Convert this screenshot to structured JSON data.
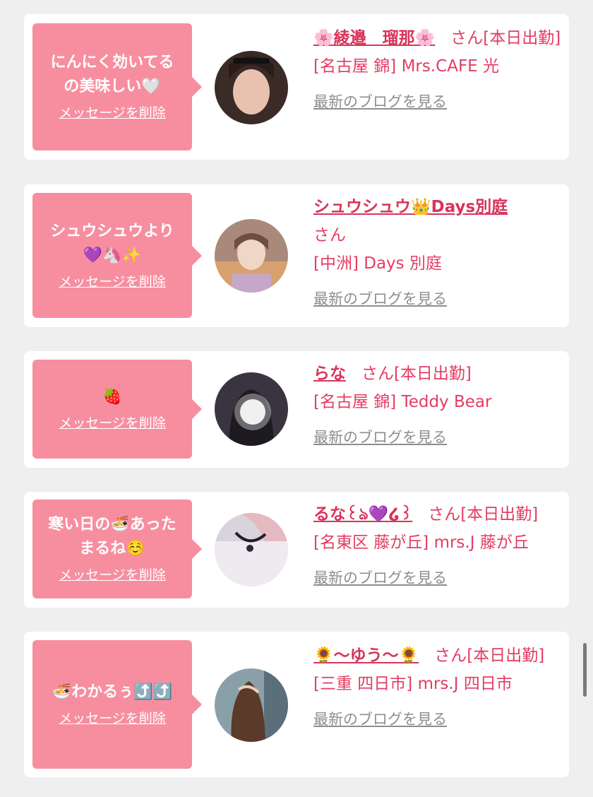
{
  "items": [
    {
      "message": "にんにく効いてる\nの美味しい🤍",
      "delete_label": "メッセージを削除",
      "name": "🌸綾邉　瑠那🌸",
      "suffix": "さん[本日出勤]",
      "shop": "[名古屋 錦] Mrs.CAFE 光",
      "blog_label": "最新のブログを見る"
    },
    {
      "message": "シュウシュウより\n💜🦄✨",
      "delete_label": "メッセージを削除",
      "name": "シュウシュウ👑Days別庭",
      "suffix": "さん",
      "shop": "[中洲] Days 別庭",
      "blog_label": "最新のブログを見る"
    },
    {
      "message": "🍓",
      "delete_label": "メッセージを削除",
      "name": "らな",
      "suffix": "さん[本日出勤]",
      "shop": "[名古屋 錦] Teddy Bear",
      "blog_label": "最新のブログを見る"
    },
    {
      "message": "寒い日の🍜あった\nまるね☺️",
      "delete_label": "メッセージを削除",
      "name": "るな꒰ঌ💜໒꒱",
      "suffix": "さん[本日出勤]",
      "shop": "[名東区 藤が丘] mrs.J 藤が丘",
      "blog_label": "最新のブログを見る"
    },
    {
      "message": "🍜わかるぅ⤴️⤴️",
      "delete_label": "メッセージを削除",
      "name": "🌻〜ゆう〜🌻",
      "suffix": "さん[本日出勤]",
      "shop": "[三重 四日市] mrs.J 四日市",
      "blog_label": "最新のブログを見る"
    }
  ],
  "colors": {
    "bubble": "#f78ea0",
    "name": "#d8345a",
    "text": "#e23d63",
    "blog": "#8e8e8e",
    "background": "#efefef"
  }
}
